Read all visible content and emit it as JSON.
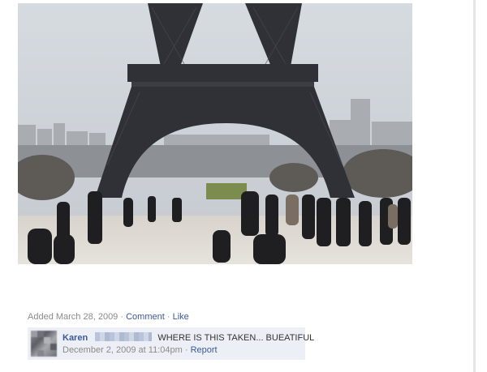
{
  "photo": {
    "alt": "Eiffel Tower photo"
  },
  "post_meta": {
    "added_label": "Added March 28, 2009",
    "separator": "·",
    "comment_link": "Comment",
    "like_link": "Like"
  },
  "comment": {
    "author": "Karen",
    "text": "WHERE IS THIS TAKEN... BUEATIFUL",
    "timestamp": "December 2, 2009 at 11:04pm",
    "separator": "·",
    "report_link": "Report"
  },
  "colors": {
    "link": "#3b5998",
    "comment_bg": "#eceff5",
    "meta_text": "#8a8a8a"
  }
}
